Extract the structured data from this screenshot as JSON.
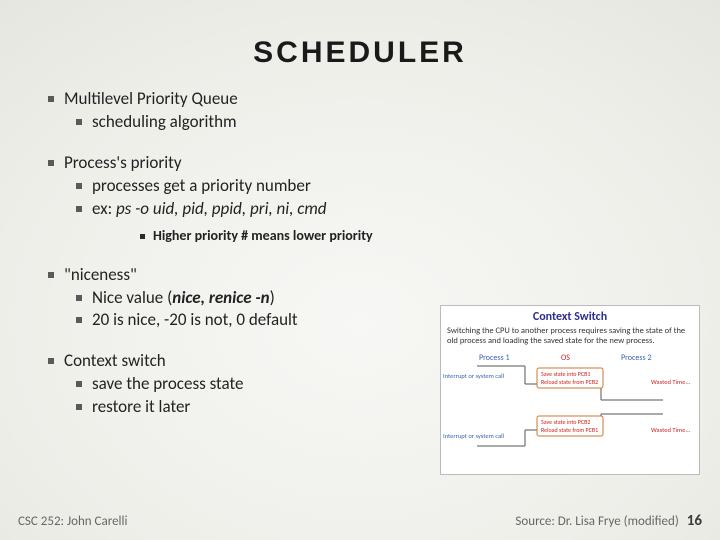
{
  "title": "SCHEDULER",
  "sections": {
    "s0": {
      "head": "Multilevel Priority Queue",
      "i0": "scheduling algorithm"
    },
    "s1": {
      "head": "Process's priority",
      "i0": "processes get a priority number",
      "i1_prefix": "ex:  ",
      "i1_cmd": "ps -o uid, pid, ppid, pri, ni, cmd",
      "note": "Higher priority # means lower priority"
    },
    "s2": {
      "head": "\"niceness\"",
      "i0_prefix": "Nice value (",
      "i0_cmd": "nice, renice -n",
      "i0_suffix": ")",
      "i1": "20 is nice, -20 is not, 0 default"
    },
    "s3": {
      "head": "Context switch",
      "i0": "save the process state",
      "i1": "restore it later"
    }
  },
  "diagram": {
    "title": "Context Switch",
    "caption": "Switching the CPU to another process requires saving the state of the old process and loading the saved state for the new process.",
    "labels": {
      "proc1": "Process 1",
      "os": "OS",
      "proc2": "Process 2",
      "left1": "Interrupt or system call",
      "left2": "Interrupt or system call",
      "right1": "Wasted Time...",
      "right2": "Wasted Time...",
      "box1a": "Save state into PCB1",
      "box1b": "Reload state from PCB2",
      "box2a": "Save state into PCB2",
      "box2b": "Reload state from PCB1"
    }
  },
  "footer": {
    "left": "CSC 252: John Carelli",
    "right": "Source: Dr. Lisa Frye (modified)",
    "page": "16"
  }
}
